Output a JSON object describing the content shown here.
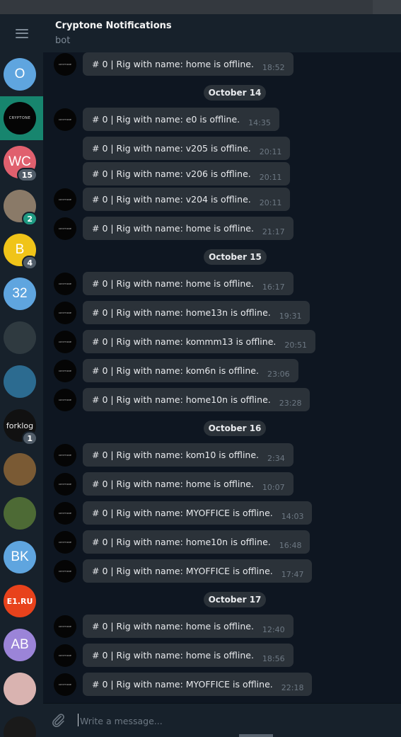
{
  "header": {
    "title": "Cryptone Notifications",
    "subtitle": "bot"
  },
  "sidebar": {
    "chats": [
      {
        "initials": "O",
        "color": "#5fa5df",
        "badge": ""
      },
      {
        "initials": "",
        "logo": "CRYPTONE",
        "color": "#050505",
        "badge": "",
        "active": true
      },
      {
        "initials": "WC",
        "color": "#e0606e",
        "badge": "15"
      },
      {
        "initials": "",
        "color": "#8a7a68",
        "badge": "2",
        "badge_style": "teal"
      },
      {
        "initials": "B",
        "color": "#f0c419",
        "badge": "4"
      },
      {
        "initials": "32",
        "color": "#5fa5df",
        "badge": ""
      },
      {
        "initials": "",
        "color": "#2f3a40",
        "badge": ""
      },
      {
        "initials": "",
        "color": "#2c6b90",
        "badge": ""
      },
      {
        "initials": "",
        "logo": "forklog",
        "color": "#111111",
        "badge": "1"
      },
      {
        "initials": "",
        "color": "#7a5a34",
        "badge": ""
      },
      {
        "initials": "",
        "color": "#4d6a35",
        "badge": ""
      },
      {
        "initials": "BK",
        "color": "#5fa5df",
        "badge": ""
      },
      {
        "initials": "",
        "logo": "E1.RU",
        "color": "#e8421c",
        "badge": ""
      },
      {
        "initials": "AB",
        "color": "#9b84d8",
        "badge": ""
      },
      {
        "initials": "",
        "color": "#d9b3b0",
        "badge": ""
      },
      {
        "initials": "",
        "color": "#1a1a1a",
        "badge": ""
      }
    ]
  },
  "avatar_logo_text": "CRYPTONE",
  "messages": [
    {
      "type": "msg",
      "text": "# 0 | Rig with name: home is offline.",
      "time": "18:52",
      "avatar": true
    },
    {
      "type": "date",
      "text": "October 14"
    },
    {
      "type": "msg",
      "text": "# 0 | Rig with name: e0 is offline.",
      "time": "14:35",
      "avatar": true
    },
    {
      "type": "msg",
      "text": "# 0 | Rig with name: v205 is offline.",
      "time": "20:11",
      "avatar": false
    },
    {
      "type": "msg",
      "text": "# 0 | Rig with name: v206 is offline.",
      "time": "20:11",
      "avatar": false
    },
    {
      "type": "msg",
      "text": "# 0 | Rig with name: v204 is offline.",
      "time": "20:11",
      "avatar": true
    },
    {
      "type": "msg",
      "text": "# 0 | Rig with name: home is offline.",
      "time": "21:17",
      "avatar": true
    },
    {
      "type": "date",
      "text": "October 15"
    },
    {
      "type": "msg",
      "text": "# 0 | Rig with name: home is offline.",
      "time": "16:17",
      "avatar": true
    },
    {
      "type": "msg",
      "text": "# 0 | Rig with name: home13n is offline.",
      "time": "19:31",
      "avatar": true
    },
    {
      "type": "msg",
      "text": "# 0 | Rig with name: kommm13 is offline.",
      "time": "20:51",
      "avatar": true
    },
    {
      "type": "msg",
      "text": "# 0 | Rig with name: kom6n is offline.",
      "time": "23:06",
      "avatar": true
    },
    {
      "type": "msg",
      "text": "# 0 | Rig with name: home10n is offline.",
      "time": "23:28",
      "avatar": true
    },
    {
      "type": "date",
      "text": "October 16"
    },
    {
      "type": "msg",
      "text": "# 0 | Rig with name: kom10 is offline.",
      "time": "2:34",
      "avatar": true
    },
    {
      "type": "msg",
      "text": "# 0 | Rig with name: home is offline.",
      "time": "10:07",
      "avatar": true
    },
    {
      "type": "msg",
      "text": "# 0 | Rig with name: MYOFFICE is offline.",
      "time": "14:03",
      "avatar": true
    },
    {
      "type": "msg",
      "text": "# 0 | Rig with name: home10n is offline.",
      "time": "16:48",
      "avatar": true
    },
    {
      "type": "msg",
      "text": "# 0 | Rig with name: MYOFFICE is offline.",
      "time": "17:47",
      "avatar": true
    },
    {
      "type": "date",
      "text": "October 17"
    },
    {
      "type": "msg",
      "text": "# 0 | Rig with name: home is offline.",
      "time": "12:40",
      "avatar": true
    },
    {
      "type": "msg",
      "text": "# 0 | Rig with name: home is offline.",
      "time": "18:56",
      "avatar": true
    },
    {
      "type": "msg",
      "text": "# 0 | Rig with name: MYOFFICE is offline.",
      "time": "22:18",
      "avatar": true
    }
  ],
  "composer": {
    "placeholder": "Write a message..."
  },
  "icons": {
    "menu": "hamburger-icon",
    "attach": "paperclip-icon"
  }
}
